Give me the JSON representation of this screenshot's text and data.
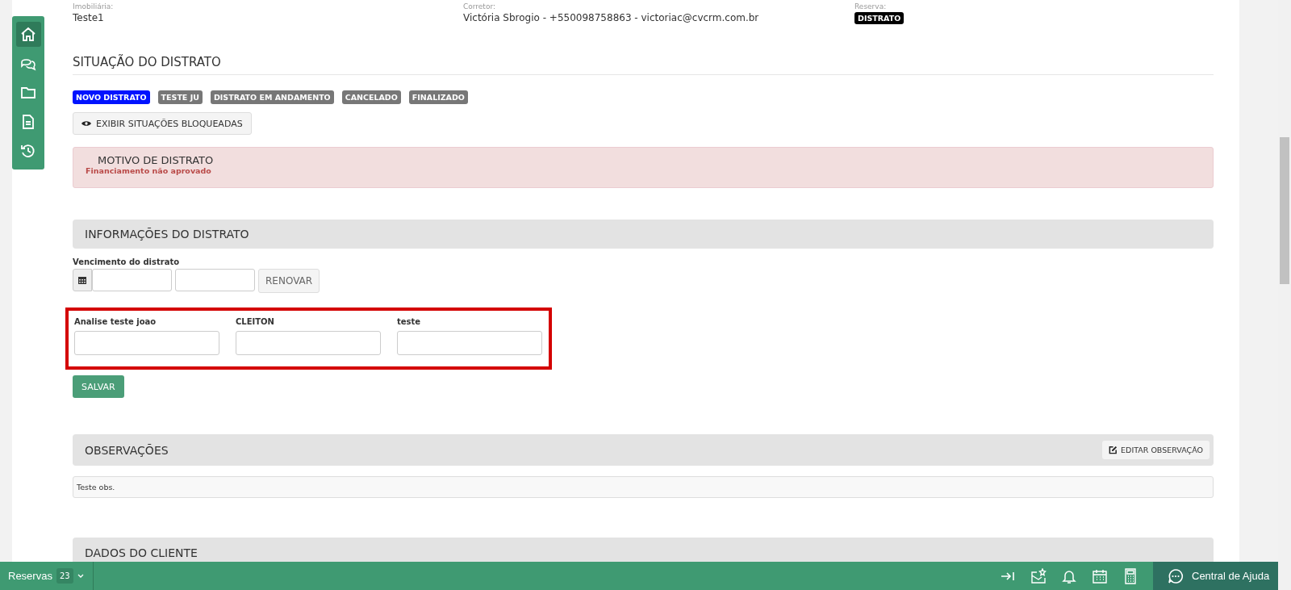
{
  "header_fields": [
    {
      "label": "Imobiliária:",
      "value": "Teste1",
      "kind": "text"
    },
    {
      "label": "Corretor:",
      "value": "Victória Sbrogio - +550098758863 - victoriac@cvcrm.com.br",
      "kind": "text"
    },
    {
      "label": "Reserva:",
      "value": "DISTRATO",
      "kind": "badge"
    }
  ],
  "side_nav": [
    {
      "kind": "home",
      "selected": true
    },
    {
      "kind": "chat",
      "selected": false
    },
    {
      "kind": "folder",
      "selected": false
    },
    {
      "kind": "document",
      "selected": false
    },
    {
      "kind": "history",
      "selected": false
    }
  ],
  "situacao": {
    "title": "SITUAÇÃO DO DISTRATO",
    "statuses": [
      {
        "label": "NOVO DISTRATO",
        "selected": true
      },
      {
        "label": "TESTE JU",
        "selected": false
      },
      {
        "label": "DISTRATO EM ANDAMENTO",
        "selected": false
      },
      {
        "label": "CANCELADO",
        "selected": false
      },
      {
        "label": "FINALIZADO",
        "selected": false
      }
    ],
    "show_blocked_button": "EXIBIR SITUAÇÕES BLOQUEADAS"
  },
  "motivo": {
    "title": "MOTIVO DE DISTRATO",
    "text": "Financiamento não aprovado"
  },
  "informacoes": {
    "title": "INFORMAÇÕES DO DISTRATO",
    "due_label": "Vencimento do distrato",
    "renew_button": "RENOVAR",
    "custom_fields_highlighted": true,
    "custom_fields": [
      {
        "label": "Analise teste joao"
      },
      {
        "label": "CLEITON"
      },
      {
        "label": "teste"
      }
    ],
    "save_button": "SALVAR"
  },
  "observacoes": {
    "title": "OBSERVAÇÕES",
    "edit_button": "EDITAR OBSERVAÇÃO",
    "text": "Teste obs."
  },
  "dados_cliente": {
    "title": "DADOS DO CLIENTE"
  },
  "bottom_bar": {
    "reservas_label": "Reservas",
    "reservas_count": "23",
    "help_label": "Central de Ajuda"
  }
}
